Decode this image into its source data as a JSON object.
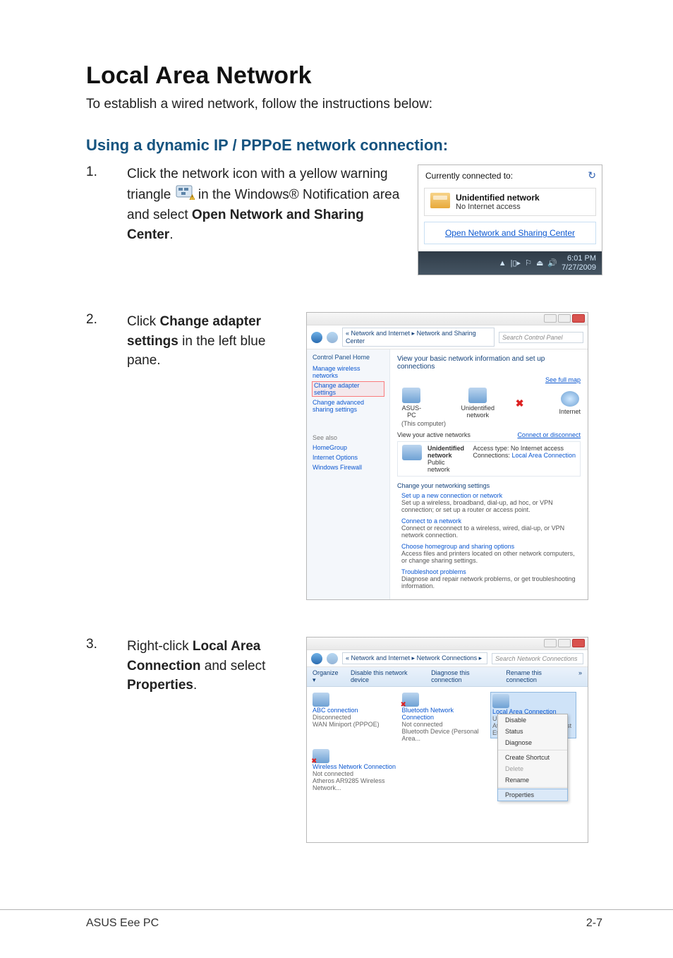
{
  "heading": "Local Area Network",
  "intro": "To establish a wired network, follow the instructions below:",
  "subheading": "Using a dynamic IP / PPPoE network connection:",
  "steps": {
    "s1": {
      "num": "1.",
      "pre": "Click the network icon with a yellow warning triangle ",
      "mid": " in the Windows® Notification area and select ",
      "bold": "Open Network and Sharing Center",
      "post": "."
    },
    "s2": {
      "num": "2.",
      "pre": "Click ",
      "bold": "Change adapter settings",
      "post": " in the left blue pane."
    },
    "s3": {
      "num": "3.",
      "pre": "Right-click ",
      "bold1": "Local Area Connection",
      "mid": " and select ",
      "bold2": "Properties",
      "post": "."
    }
  },
  "shot1": {
    "connected_label": "Currently connected to:",
    "net_name": "Unidentified network",
    "net_status": "No Internet access",
    "link": "Open Network and Sharing Center",
    "tray_glyphs": [
      "▲",
      "|▯▸",
      "⚐",
      "⏏",
      "🔊"
    ],
    "time": "6:01 PM",
    "date": "7/27/2009"
  },
  "shot2": {
    "crumbs": "« Network and Internet ▸ Network and Sharing Center",
    "search_ph": "Search Control Panel",
    "side": {
      "home": "Control Panel Home",
      "links": [
        "Manage wireless networks",
        "Change adapter settings",
        "Change advanced sharing settings"
      ],
      "seealso": "See also",
      "seealso_items": [
        "HomeGroup",
        "Internet Options",
        "Windows Firewall"
      ]
    },
    "main": {
      "hdr": "View your basic network information and set up connections",
      "fullmap": "See full map",
      "nodes": {
        "pc": "ASUS-PC",
        "pc_sub": "(This computer)",
        "net": "Unidentified network",
        "inet": "Internet"
      },
      "view": "View your active networks",
      "connect": "Connect or disconnect",
      "netbox": {
        "t1": "Unidentified network",
        "t2": "Public network",
        "r1l": "Access type:",
        "r1v": "No Internet access",
        "r2l": "Connections:",
        "r2v": "Local Area Connection"
      },
      "change": "Change your networking settings",
      "items": [
        {
          "t": "Set up a new connection or network",
          "d": "Set up a wireless, broadband, dial-up, ad hoc, or VPN connection; or set up a router or access point."
        },
        {
          "t": "Connect to a network",
          "d": "Connect or reconnect to a wireless, wired, dial-up, or VPN network connection."
        },
        {
          "t": "Choose homegroup and sharing options",
          "d": "Access files and printers located on other network computers, or change sharing settings."
        },
        {
          "t": "Troubleshoot problems",
          "d": "Diagnose and repair network problems, or get troubleshooting information."
        }
      ]
    }
  },
  "shot3": {
    "crumbs": "« Network and Internet ▸ Network Connections ▸",
    "search_ph": "Search Network Connections",
    "toolbar": [
      "Organize ▾",
      "Disable this network device",
      "Diagnose this connection",
      "Rename this connection",
      "»"
    ],
    "conns": [
      {
        "name": "ABC connection",
        "status": "Disconnected",
        "dev": "WAN Miniport (PPPOE)"
      },
      {
        "name": "Bluetooth Network Connection",
        "status": "Not connected",
        "dev": "Bluetooth Device (Personal Area..."
      },
      {
        "name": "Local Area Connection",
        "status": "Unidentified network",
        "dev": "Atheros AR8132 PCI-E Fast Ethern..."
      },
      {
        "name": "Wireless Network Connection",
        "status": "Not connected",
        "dev": "Atheros AR9285 Wireless Network..."
      }
    ],
    "menu": [
      "Disable",
      "Status",
      "Diagnose",
      "Create Shortcut",
      "Delete",
      "Rename",
      "Properties"
    ]
  },
  "footer": {
    "left": "ASUS Eee PC",
    "right": "2-7"
  }
}
